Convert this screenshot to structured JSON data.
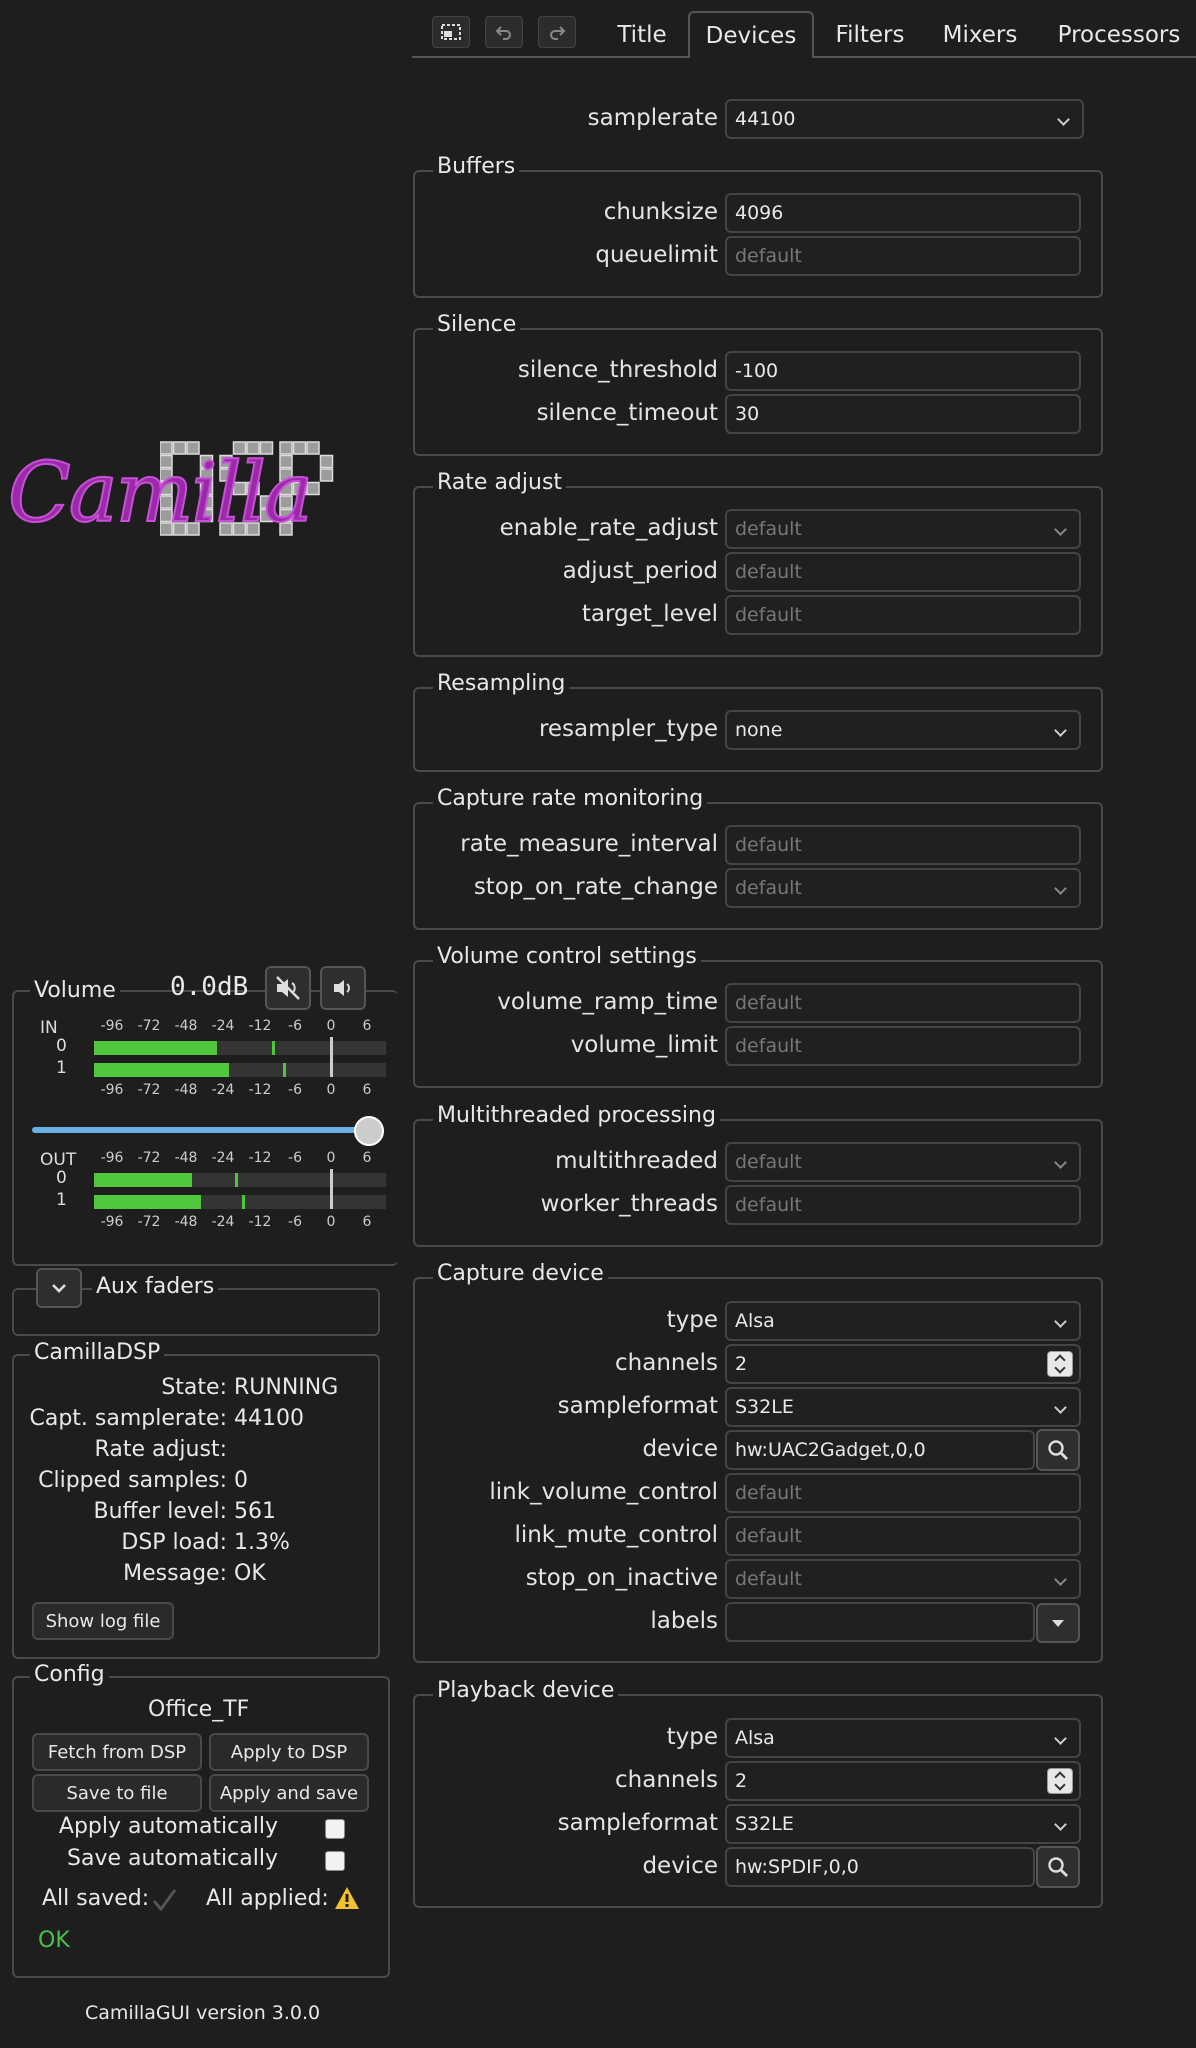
{
  "toolbar": {
    "icons": [
      "screenshot-icon",
      "undo-icon",
      "redo-icon"
    ]
  },
  "tabs": [
    "Title",
    "Devices",
    "Filters",
    "Mixers",
    "Processors"
  ],
  "active_tab": "Devices",
  "devices": {
    "samplerate": {
      "label": "samplerate",
      "value": "44100"
    },
    "buffers": {
      "title": "Buffers",
      "chunksize": {
        "label": "chunksize",
        "value": "4096"
      },
      "queuelimit": {
        "label": "queuelimit",
        "placeholder": "default"
      }
    },
    "silence": {
      "title": "Silence",
      "threshold": {
        "label": "silence_threshold",
        "value": "-100"
      },
      "timeout": {
        "label": "silence_timeout",
        "value": "30"
      }
    },
    "rate_adjust": {
      "title": "Rate adjust",
      "enable": {
        "label": "enable_rate_adjust",
        "placeholder": "default"
      },
      "period": {
        "label": "adjust_period",
        "placeholder": "default"
      },
      "target": {
        "label": "target_level",
        "placeholder": "default"
      }
    },
    "resampling": {
      "title": "Resampling",
      "type": {
        "label": "resampler_type",
        "value": "none"
      }
    },
    "capture_rate": {
      "title": "Capture rate monitoring",
      "interval": {
        "label": "rate_measure_interval",
        "placeholder": "default"
      },
      "stop": {
        "label": "stop_on_rate_change",
        "placeholder": "default"
      }
    },
    "volume_ctrl": {
      "title": "Volume control settings",
      "ramp": {
        "label": "volume_ramp_time",
        "placeholder": "default"
      },
      "limit": {
        "label": "volume_limit",
        "placeholder": "default"
      }
    },
    "multithread": {
      "title": "Multithreaded processing",
      "enabled": {
        "label": "multithreaded",
        "placeholder": "default"
      },
      "workers": {
        "label": "worker_threads",
        "placeholder": "default"
      }
    },
    "capture": {
      "title": "Capture device",
      "type": {
        "label": "type",
        "value": "Alsa"
      },
      "channels": {
        "label": "channels",
        "value": "2"
      },
      "format": {
        "label": "sampleformat",
        "value": "S32LE"
      },
      "device": {
        "label": "device",
        "value": "hw:UAC2Gadget,0,0"
      },
      "link_volume": {
        "label": "link_volume_control",
        "placeholder": "default"
      },
      "link_mute": {
        "label": "link_mute_control",
        "placeholder": "default"
      },
      "stop_inactive": {
        "label": "stop_on_inactive",
        "placeholder": "default"
      },
      "labels": {
        "label": "labels",
        "value": ""
      }
    },
    "playback": {
      "title": "Playback device",
      "type": {
        "label": "type",
        "value": "Alsa"
      },
      "channels": {
        "label": "channels",
        "value": "2"
      },
      "format": {
        "label": "sampleformat",
        "value": "S32LE"
      },
      "device": {
        "label": "device",
        "value": "hw:SPDIF,0,0"
      }
    }
  },
  "logo": {
    "script": "Camilla",
    "blocks": "DSP"
  },
  "volume": {
    "title": "Volume",
    "value": "0.0dB",
    "slider_fraction": 1.0,
    "scale": [
      "-96",
      "-72",
      "-48",
      "-24",
      "-12",
      "-6",
      "0",
      "6"
    ],
    "in_label": "IN",
    "out_label": "OUT",
    "channels": [
      "0",
      "1"
    ],
    "in_levels_db": [
      -28,
      -22
    ],
    "in_peaks_db": [
      -10,
      -8
    ],
    "out_levels_db": [
      -44,
      -38
    ],
    "out_peaks_db": [
      -20,
      -18
    ],
    "colors": {
      "meter": "#4fc63c",
      "slider": "#6ab0e0"
    }
  },
  "aux": {
    "title": "Aux faders"
  },
  "status": {
    "title": "CamillaDSP",
    "rows": [
      {
        "k": "State:",
        "v": "RUNNING"
      },
      {
        "k": "Capt. samplerate:",
        "v": "44100"
      },
      {
        "k": "Rate adjust:",
        "v": ""
      },
      {
        "k": "Clipped samples:",
        "v": "0"
      },
      {
        "k": "Buffer level:",
        "v": "561"
      },
      {
        "k": "DSP load:",
        "v": "1.3%"
      },
      {
        "k": "Message:",
        "v": "OK"
      }
    ],
    "log_button": "Show log file"
  },
  "config": {
    "title": "Config",
    "name": "Office_TF",
    "fetch": "Fetch from DSP",
    "apply": "Apply to DSP",
    "save": "Save to file",
    "apply_save": "Apply and save",
    "auto_apply": "Apply automatically",
    "auto_save": "Save automatically",
    "all_saved": "All saved:",
    "all_applied": "All applied:",
    "status": "OK"
  },
  "version": "CamillaGUI version 3.0.0"
}
